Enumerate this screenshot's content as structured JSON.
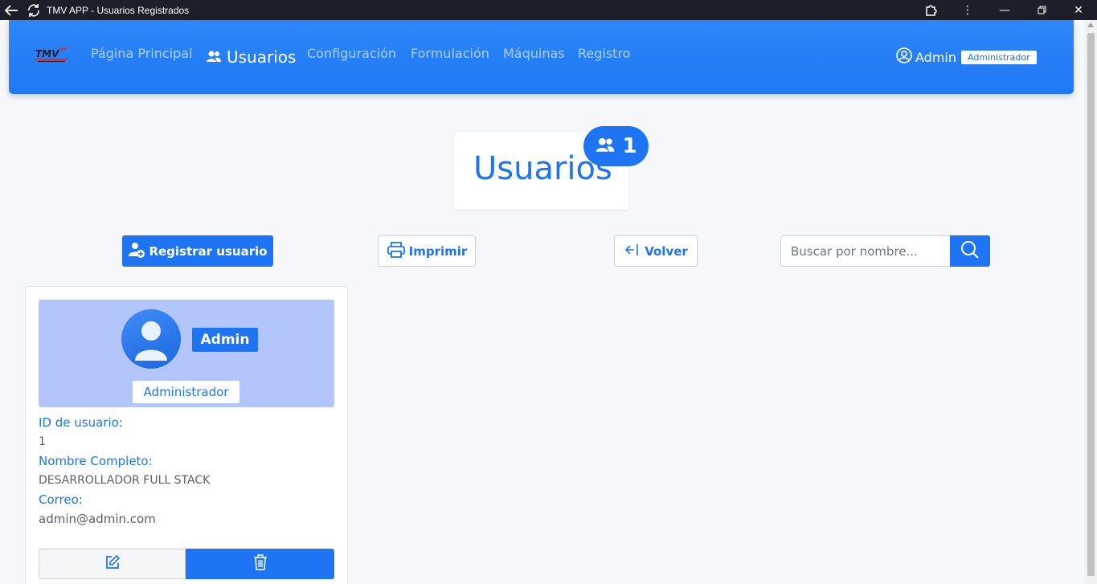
{
  "window": {
    "title": "TMV APP - Usuarios Registrados"
  },
  "navbar": {
    "logo_text": "TMV",
    "items": [
      {
        "label": "Página Principal"
      },
      {
        "label": "Usuarios"
      },
      {
        "label": "Configuración"
      },
      {
        "label": "Formulación"
      },
      {
        "label": "Máquinas"
      },
      {
        "label": "Registro"
      }
    ],
    "user_name": "Admin",
    "user_role": "Administrador"
  },
  "page": {
    "title": "Usuarios",
    "count": "1"
  },
  "toolbar": {
    "register_label": "Registrar usuario",
    "print_label": "Imprimir",
    "back_label": "Volver",
    "search_placeholder": "Buscar por nombre..."
  },
  "users": [
    {
      "name": "Admin",
      "role": "Administrador",
      "id_label": "ID de usuario:",
      "id": "1",
      "fullname_label": "Nombre Completo:",
      "fullname": "DESARROLLADOR FULL STACK",
      "email_label": "Correo:",
      "email": "admin@admin.com"
    }
  ],
  "colors": {
    "accent": "#1e74f2",
    "header_bg": "#b2c6fb"
  }
}
